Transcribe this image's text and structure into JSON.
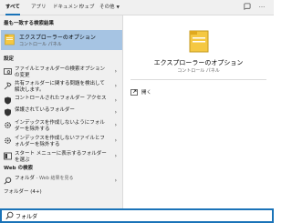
{
  "tabs": [
    {
      "label": "すべて"
    },
    {
      "label": "アプリ"
    },
    {
      "label": "ドキュメント"
    },
    {
      "label": "ウェブ"
    },
    {
      "label": "その他",
      "dropdown": true
    }
  ],
  "toolbar_icons": [
    "feedback-icon",
    "more-options-icon"
  ],
  "left": {
    "best_match_heading": "最も一致する検索結果",
    "best_match": {
      "title": "エクスプローラーのオプション",
      "subtitle": "コントロール パネル"
    },
    "settings_heading": "設定",
    "settings": [
      {
        "label": "ファイルとフォルダーの検索オプションの変更",
        "icon": "search-folder-icon"
      },
      {
        "label": "共有フォルダーに関する問題を検出して解決します。",
        "icon": "troubleshoot-icon"
      },
      {
        "label": "コントロールされたフォルダー アクセス",
        "icon": "shield-icon"
      },
      {
        "label": "保護されているフォルダー",
        "icon": "shield-icon"
      },
      {
        "label": "インデックスを作成しないようにフォルダーを除外する",
        "icon": "gear-icon"
      },
      {
        "label": "インデックスを作成しないファイルとフォルダーを除外する",
        "icon": "gear-icon"
      },
      {
        "label": "スタート メニューに表示するフォルダーを選ぶ",
        "icon": "start-menu-icon"
      }
    ],
    "web_heading": "Web の検索",
    "web": {
      "query": "フォルダ",
      "suffix": " - Web 結果を見る"
    },
    "cut_off_heading": "フォルダー (4+)"
  },
  "right": {
    "title": "エクスプローラーのオプション",
    "subtitle": "コントロール パネル",
    "open_label": "開く"
  },
  "search": {
    "value": "フォルダ",
    "placeholder": ""
  },
  "colors": {
    "accent": "#1a73b8",
    "selection": "#a6c4e3",
    "pane_bg": "#f0f0f0",
    "folder_yellow": "#f5c842"
  }
}
